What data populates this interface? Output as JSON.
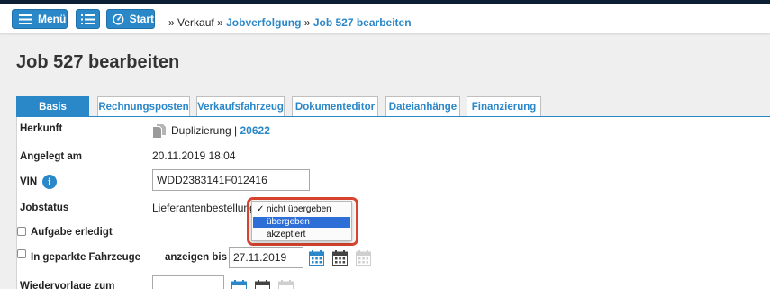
{
  "colors": {
    "accent": "#2a87c8",
    "highlight_ring": "#d9452f",
    "dropdown_selection": "#2d6fd6",
    "topline": "#0c1f33"
  },
  "toolbar": {
    "menu_label": "Menü",
    "menu_icon": "hamburger-icon",
    "list_icon": "list-icon",
    "start_label": "Start",
    "start_icon": "dashboard-icon"
  },
  "breadcrumb": {
    "separator": "»",
    "items": [
      {
        "label": "Verkauf",
        "link": false
      },
      {
        "label": "Jobverfolgung",
        "link": true
      },
      {
        "label": "Job 527 bearbeiten",
        "link": true
      }
    ]
  },
  "page": {
    "title": "Job 527 bearbeiten"
  },
  "tabs": [
    {
      "label": "Basis",
      "active": true
    },
    {
      "label": "Rechnungsposten",
      "active": false
    },
    {
      "label": "Verkaufsfahrzeug",
      "active": false
    },
    {
      "label": "Dokumenteditor",
      "active": false
    },
    {
      "label": "Dateianhänge",
      "active": false
    },
    {
      "label": "Finanzierung",
      "active": false
    }
  ],
  "form": {
    "herkunft": {
      "label": "Herkunft",
      "icon": "copy-document-icon",
      "value": "Duplizierung |",
      "link": "20622"
    },
    "angelegt": {
      "label": "Angelegt am",
      "value": "20.11.2019 18:04"
    },
    "vin": {
      "label": "VIN",
      "icon": "info-icon",
      "value": "WDD2383141F012416"
    },
    "jobstatus": {
      "label": "Jobstatus",
      "value": "Lieferantenbestellung",
      "options": [
        {
          "label": "nicht übergeben",
          "checked": true
        },
        {
          "label": "übergeben",
          "selected": true
        },
        {
          "label": "akzeptiert"
        }
      ],
      "checkmark": "✓"
    },
    "aufgabe": {
      "label": "Aufgabe erledigt",
      "checked": false
    },
    "geparkt": {
      "label": "In geparkte Fahrzeuge",
      "checked": false,
      "anzeigen_label": "anzeigen bis",
      "date": "27.11.2019",
      "icons": [
        "calendar-icon",
        "calendar-dark-icon",
        "calendar-disabled-icon"
      ]
    },
    "wiedervorlage": {
      "label": "Wiedervorlage zum",
      "value": ""
    }
  }
}
